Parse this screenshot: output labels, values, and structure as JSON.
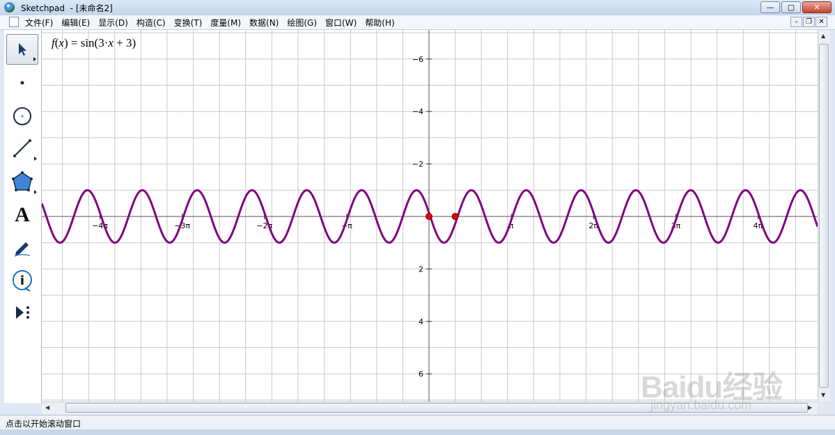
{
  "window": {
    "app_name": "Sketchpad",
    "title_suffix": "- [未命名2]"
  },
  "window_controls": {
    "minimize": "—",
    "maximize": "▢",
    "close": "✕"
  },
  "menu": {
    "items": [
      "文件(F)",
      "编辑(E)",
      "显示(D)",
      "构造(C)",
      "变换(T)",
      "度量(M)",
      "数据(N)",
      "绘图(G)",
      "窗口(W)",
      "帮助(H)"
    ]
  },
  "doc_controls": {
    "minimize": "–",
    "restore": "❐",
    "close": "✕"
  },
  "toolbox": {
    "tools": [
      "arrow-tool",
      "point-tool",
      "compass-tool",
      "straightedge-tool",
      "polygon-tool",
      "text-tool",
      "marker-tool",
      "information-tool",
      "custom-tool"
    ],
    "text_tool_glyph": "A",
    "info_tool_glyph": "i"
  },
  "graph": {
    "function_label": {
      "f": "f",
      "open": "(",
      "x": "x",
      "close_eq": ") = sin(3·",
      "x2": "x",
      "tail": " + 3)"
    },
    "y_tick_labels": [
      "6",
      "4",
      "2",
      "−2",
      "−4",
      "−6"
    ],
    "x_tick_labels": [
      "−4π",
      "−3π",
      "−2π",
      "−π",
      "π",
      "2π",
      "3π",
      "4π"
    ],
    "curve_color": "#800080",
    "point_color": "#e00000",
    "grid_color": "#c8c8c8"
  },
  "chart_data": {
    "type": "line",
    "title": "",
    "series": [
      {
        "name": "f(x) = sin(3·x + 3)",
        "expression": "sin(3·x + 3)"
      }
    ],
    "xlim": [
      -14.9,
      14.9
    ],
    "ylim": [
      -7.2,
      7.1
    ],
    "y_ticks": [
      -6,
      -4,
      -2,
      2,
      4,
      6
    ],
    "x_ticks": [
      "−4π",
      "−3π",
      "−2π",
      "−π",
      "π",
      "2π",
      "3π",
      "4π"
    ],
    "points": [
      {
        "x": 0,
        "y": 0
      },
      {
        "x": 1,
        "y": 0
      }
    ],
    "grid": true
  },
  "status": {
    "text": "点击以开始滚动窗口"
  },
  "watermark": {
    "main": "Baidu经验",
    "sub": "jingyan.baidu.com"
  }
}
